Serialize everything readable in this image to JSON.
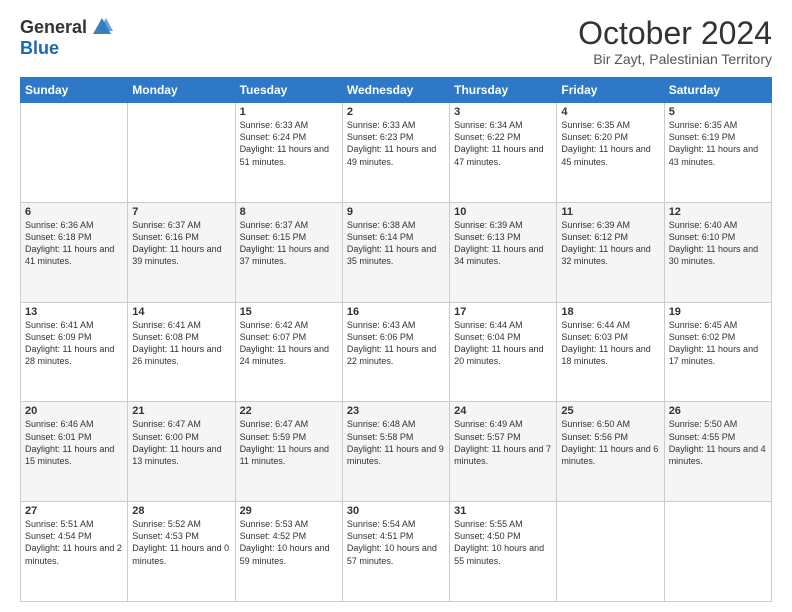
{
  "header": {
    "logo_general": "General",
    "logo_blue": "Blue",
    "title": "October 2024",
    "location": "Bir Zayt, Palestinian Territory"
  },
  "days_of_week": [
    "Sunday",
    "Monday",
    "Tuesday",
    "Wednesday",
    "Thursday",
    "Friday",
    "Saturday"
  ],
  "weeks": [
    [
      {
        "day": "",
        "info": ""
      },
      {
        "day": "",
        "info": ""
      },
      {
        "day": "1",
        "info": "Sunrise: 6:33 AM\nSunset: 6:24 PM\nDaylight: 11 hours and 51 minutes."
      },
      {
        "day": "2",
        "info": "Sunrise: 6:33 AM\nSunset: 6:23 PM\nDaylight: 11 hours and 49 minutes."
      },
      {
        "day": "3",
        "info": "Sunrise: 6:34 AM\nSunset: 6:22 PM\nDaylight: 11 hours and 47 minutes."
      },
      {
        "day": "4",
        "info": "Sunrise: 6:35 AM\nSunset: 6:20 PM\nDaylight: 11 hours and 45 minutes."
      },
      {
        "day": "5",
        "info": "Sunrise: 6:35 AM\nSunset: 6:19 PM\nDaylight: 11 hours and 43 minutes."
      }
    ],
    [
      {
        "day": "6",
        "info": "Sunrise: 6:36 AM\nSunset: 6:18 PM\nDaylight: 11 hours and 41 minutes."
      },
      {
        "day": "7",
        "info": "Sunrise: 6:37 AM\nSunset: 6:16 PM\nDaylight: 11 hours and 39 minutes."
      },
      {
        "day": "8",
        "info": "Sunrise: 6:37 AM\nSunset: 6:15 PM\nDaylight: 11 hours and 37 minutes."
      },
      {
        "day": "9",
        "info": "Sunrise: 6:38 AM\nSunset: 6:14 PM\nDaylight: 11 hours and 35 minutes."
      },
      {
        "day": "10",
        "info": "Sunrise: 6:39 AM\nSunset: 6:13 PM\nDaylight: 11 hours and 34 minutes."
      },
      {
        "day": "11",
        "info": "Sunrise: 6:39 AM\nSunset: 6:12 PM\nDaylight: 11 hours and 32 minutes."
      },
      {
        "day": "12",
        "info": "Sunrise: 6:40 AM\nSunset: 6:10 PM\nDaylight: 11 hours and 30 minutes."
      }
    ],
    [
      {
        "day": "13",
        "info": "Sunrise: 6:41 AM\nSunset: 6:09 PM\nDaylight: 11 hours and 28 minutes."
      },
      {
        "day": "14",
        "info": "Sunrise: 6:41 AM\nSunset: 6:08 PM\nDaylight: 11 hours and 26 minutes."
      },
      {
        "day": "15",
        "info": "Sunrise: 6:42 AM\nSunset: 6:07 PM\nDaylight: 11 hours and 24 minutes."
      },
      {
        "day": "16",
        "info": "Sunrise: 6:43 AM\nSunset: 6:06 PM\nDaylight: 11 hours and 22 minutes."
      },
      {
        "day": "17",
        "info": "Sunrise: 6:44 AM\nSunset: 6:04 PM\nDaylight: 11 hours and 20 minutes."
      },
      {
        "day": "18",
        "info": "Sunrise: 6:44 AM\nSunset: 6:03 PM\nDaylight: 11 hours and 18 minutes."
      },
      {
        "day": "19",
        "info": "Sunrise: 6:45 AM\nSunset: 6:02 PM\nDaylight: 11 hours and 17 minutes."
      }
    ],
    [
      {
        "day": "20",
        "info": "Sunrise: 6:46 AM\nSunset: 6:01 PM\nDaylight: 11 hours and 15 minutes."
      },
      {
        "day": "21",
        "info": "Sunrise: 6:47 AM\nSunset: 6:00 PM\nDaylight: 11 hours and 13 minutes."
      },
      {
        "day": "22",
        "info": "Sunrise: 6:47 AM\nSunset: 5:59 PM\nDaylight: 11 hours and 11 minutes."
      },
      {
        "day": "23",
        "info": "Sunrise: 6:48 AM\nSunset: 5:58 PM\nDaylight: 11 hours and 9 minutes."
      },
      {
        "day": "24",
        "info": "Sunrise: 6:49 AM\nSunset: 5:57 PM\nDaylight: 11 hours and 7 minutes."
      },
      {
        "day": "25",
        "info": "Sunrise: 6:50 AM\nSunset: 5:56 PM\nDaylight: 11 hours and 6 minutes."
      },
      {
        "day": "26",
        "info": "Sunrise: 5:50 AM\nSunset: 4:55 PM\nDaylight: 11 hours and 4 minutes."
      }
    ],
    [
      {
        "day": "27",
        "info": "Sunrise: 5:51 AM\nSunset: 4:54 PM\nDaylight: 11 hours and 2 minutes."
      },
      {
        "day": "28",
        "info": "Sunrise: 5:52 AM\nSunset: 4:53 PM\nDaylight: 11 hours and 0 minutes."
      },
      {
        "day": "29",
        "info": "Sunrise: 5:53 AM\nSunset: 4:52 PM\nDaylight: 10 hours and 59 minutes."
      },
      {
        "day": "30",
        "info": "Sunrise: 5:54 AM\nSunset: 4:51 PM\nDaylight: 10 hours and 57 minutes."
      },
      {
        "day": "31",
        "info": "Sunrise: 5:55 AM\nSunset: 4:50 PM\nDaylight: 10 hours and 55 minutes."
      },
      {
        "day": "",
        "info": ""
      },
      {
        "day": "",
        "info": ""
      }
    ]
  ]
}
